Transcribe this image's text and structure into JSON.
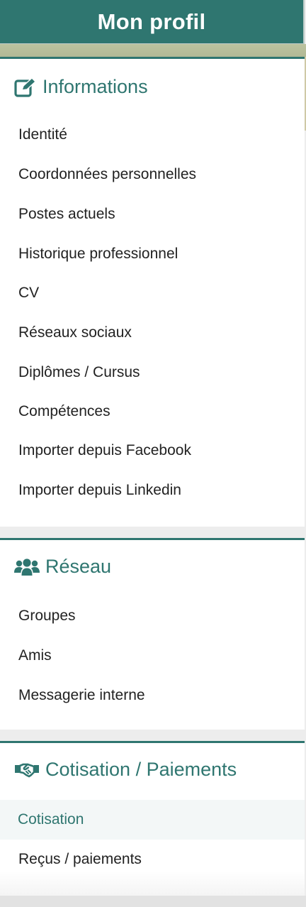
{
  "header": {
    "title": "Mon profil"
  },
  "sections": {
    "informations": {
      "title": "Informations",
      "icon": "edit-icon",
      "items": [
        "Identité",
        "Coordonnées personnelles",
        "Postes actuels",
        "Historique professionnel",
        "CV",
        "Réseaux sociaux",
        "Diplômes / Cursus",
        "Compétences",
        "Importer depuis Facebook",
        "Importer depuis Linkedin"
      ]
    },
    "reseau": {
      "title": "Réseau",
      "icon": "users-icon",
      "items": [
        "Groupes",
        "Amis",
        "Messagerie interne"
      ]
    },
    "cotisation": {
      "title": "Cotisation / Paiements",
      "icon": "handshake-icon",
      "items": [
        "Cotisation",
        "Reçus / paiements"
      ],
      "active_item": "Cotisation"
    }
  },
  "colors": {
    "brand": "#2f7670",
    "text": "#222222",
    "active_background": "#f3f7f7",
    "separator": "#ededed"
  }
}
